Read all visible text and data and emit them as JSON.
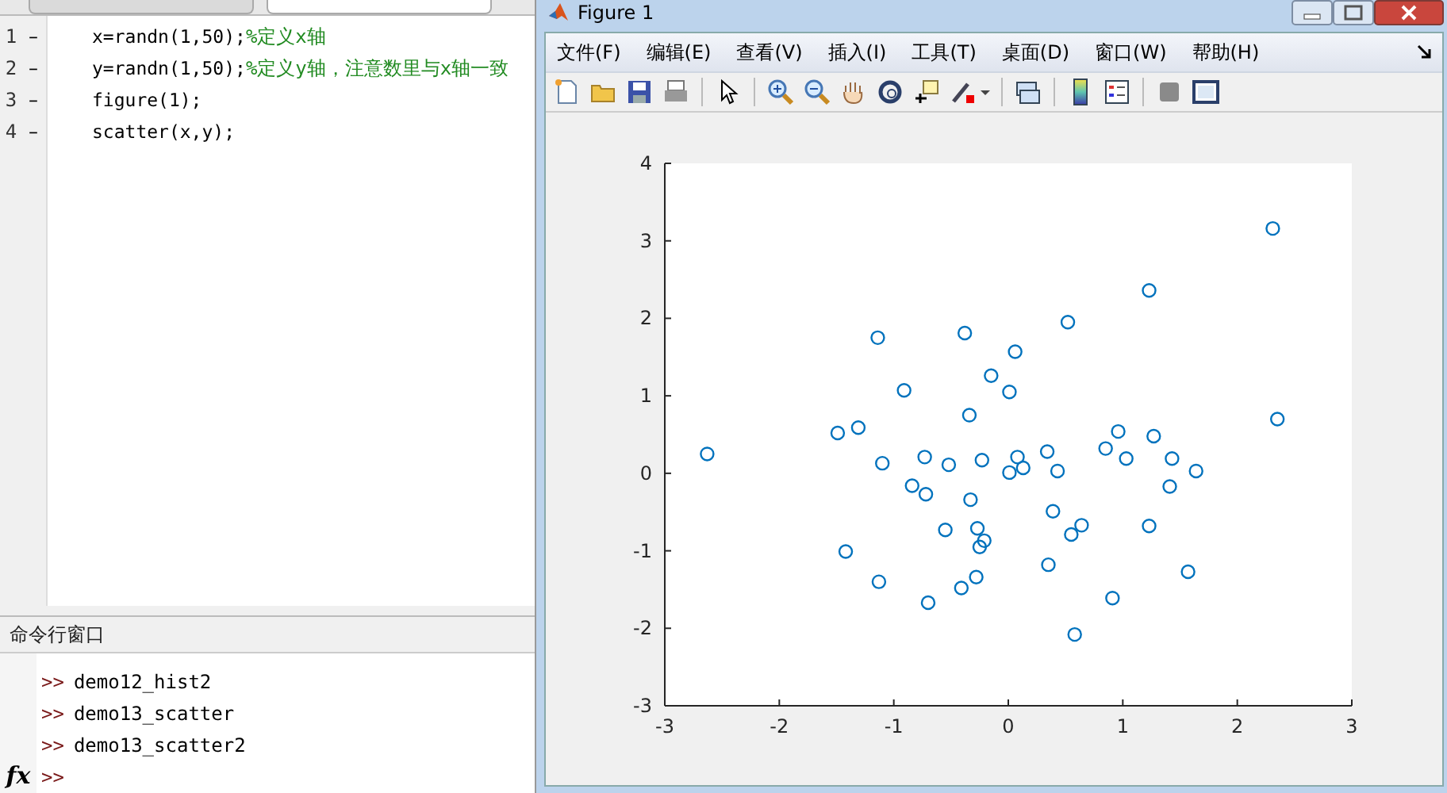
{
  "editor": {
    "lines": [
      {
        "number": "1",
        "marker": "–",
        "code": "x=randn(1,50);",
        "comment": "%定义x轴"
      },
      {
        "number": "2",
        "marker": "–",
        "code": "y=randn(1,50);",
        "comment": "%定义y轴，注意数里与x轴一致"
      },
      {
        "number": "3",
        "marker": "–",
        "code": "figure(1);"
      },
      {
        "number": "4",
        "marker": "–",
        "code": "scatter(x,y);"
      }
    ]
  },
  "command_window": {
    "title": "命令行窗口",
    "prompt": ">>",
    "history": [
      "demo12_hist2",
      "demo13_scatter",
      "demo13_scatter2"
    ],
    "fx_label": "fx"
  },
  "figure": {
    "title": "Figure 1",
    "menu": [
      "文件(F)",
      "编辑(E)",
      "查看(V)",
      "插入(I)",
      "工具(T)",
      "桌面(D)",
      "窗口(W)",
      "帮助(H)"
    ],
    "chart_data": {
      "type": "scatter",
      "xlim": [
        -3,
        3
      ],
      "ylim": [
        -3,
        4
      ],
      "xticks": [
        -3,
        -2,
        -1,
        0,
        1,
        2,
        3
      ],
      "yticks": [
        -3,
        -2,
        -1,
        0,
        1,
        2,
        3,
        4
      ],
      "series": [
        {
          "color": "#0072bd",
          "x": [
            -2.63,
            -1.49,
            -1.31,
            -1.14,
            -1.1,
            -0.91,
            -0.84,
            -0.73,
            -0.72,
            -0.52,
            -0.34,
            -0.38,
            -0.23,
            -0.15,
            0.01,
            0.06,
            0.01,
            0.08,
            0.13,
            0.34,
            0.43,
            0.52,
            0.85,
            0.96,
            1.03,
            1.23,
            1.27,
            1.43,
            1.64,
            2.31,
            2.35,
            -1.42,
            -1.13,
            -0.7,
            -0.41,
            -0.28,
            -0.55,
            -0.27,
            -0.21,
            -0.25,
            -0.33,
            0.39,
            0.64,
            0.55,
            0.35,
            0.58,
            0.91,
            1.23,
            1.57,
            1.41
          ],
          "values": [
            0.25,
            0.52,
            0.59,
            1.75,
            0.13,
            1.07,
            -0.16,
            0.21,
            -0.27,
            0.11,
            0.75,
            1.81,
            0.17,
            1.26,
            1.05,
            1.57,
            0.01,
            0.21,
            0.07,
            0.28,
            0.03,
            1.95,
            0.32,
            0.54,
            0.19,
            2.36,
            0.48,
            0.19,
            0.03,
            3.16,
            0.7,
            -1.01,
            -1.4,
            -1.67,
            -1.48,
            -1.34,
            -0.73,
            -0.71,
            -0.87,
            -0.95,
            -0.34,
            -0.49,
            -0.67,
            -0.79,
            -1.18,
            -2.08,
            -1.61,
            -0.68,
            -1.27,
            -0.17
          ]
        }
      ]
    }
  }
}
